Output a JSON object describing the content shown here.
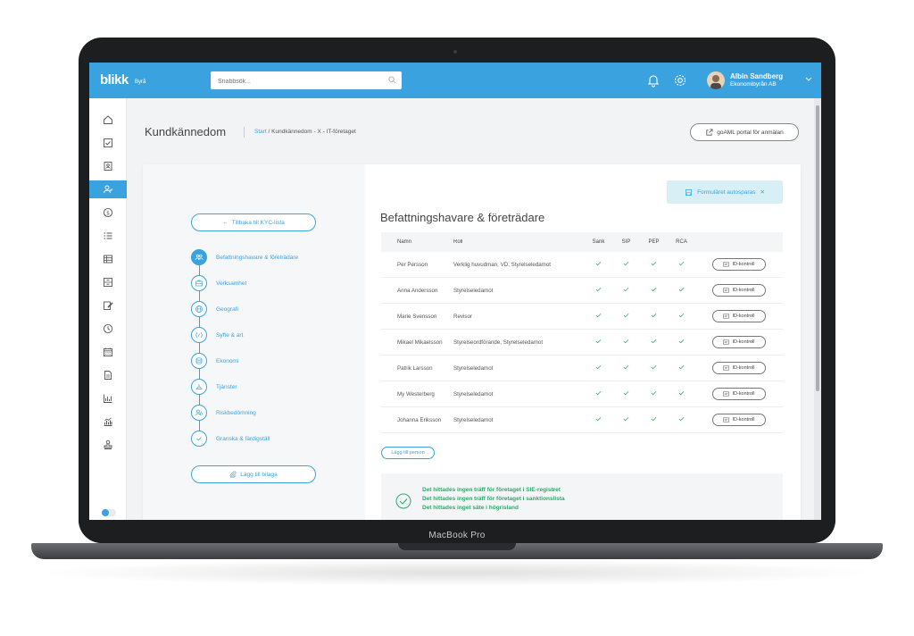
{
  "header": {
    "logo": "blikk",
    "logo_sub": "Byrå",
    "search_placeholder": "Snabbsök...",
    "user_name": "Albin Sandberg",
    "user_org": "Ekonomibyrån AB"
  },
  "sidebar": {
    "items": [
      "home-icon",
      "checkbox-icon",
      "contact-card-icon",
      "user-check-icon",
      "dollar-icon",
      "list-icon",
      "table-icon",
      "archive-icon",
      "edit-icon",
      "clock-icon",
      "calendar-icon",
      "document-icon",
      "bar-chart-icon",
      "analytics-icon",
      "stamp-icon"
    ]
  },
  "page": {
    "title": "Kundkännedom",
    "breadcrumb_link": "Start",
    "breadcrumb_rest": " / Kundkännedom - X - IT-företaget",
    "goaml_label": "goAML portal för anmälan"
  },
  "left": {
    "back_label": "Tillbaka till KYC-lista",
    "steps": [
      {
        "label": "Befattningshavare & företrädare",
        "icon": "people-icon"
      },
      {
        "label": "Verksamhet",
        "icon": "briefcase-icon"
      },
      {
        "label": "Geografi",
        "icon": "globe-icon"
      },
      {
        "label": "Syfte & art",
        "icon": "code-brackets-icon"
      },
      {
        "label": "Ekonomi",
        "icon": "coins-icon"
      },
      {
        "label": "Tjänster",
        "icon": "service-icon"
      },
      {
        "label": "Riskbedömning",
        "icon": "risk-icon"
      },
      {
        "label": "Granska & färdigställ",
        "icon": "check-icon"
      }
    ],
    "attach_label": "Lägg till bilaga"
  },
  "main": {
    "autosave_label": "Formuläret autosparas",
    "section_title": "Befattningshavare & företrädare",
    "columns": {
      "name": "Namn",
      "role": "Roll",
      "sank": "Sank",
      "sip": "SIP",
      "pep": "PEP",
      "rca": "RCA"
    },
    "id_button_label": "ID-kontroll",
    "rows": [
      {
        "name": "Per Persson",
        "role": "Verklig huvudman, VD, Styrelseledamot"
      },
      {
        "name": "Anna Andersson",
        "role": "Styrelseledamot"
      },
      {
        "name": "Marie Svensson",
        "role": "Revisor"
      },
      {
        "name": "Mikael Mikaelsson",
        "role": "Styrelseordförande, Styrelseledamot"
      },
      {
        "name": "Patrik Larsson",
        "role": "Styrelseledamot"
      },
      {
        "name": "My Westerberg",
        "role": "Styrelseledamot"
      },
      {
        "name": "Johanna Eriksson",
        "role": "Styrelseledamot"
      }
    ],
    "add_person_label": "Lägg till person",
    "results": [
      "Det hittades ingen träff för företaget i SIE-registret",
      "Det hittades ingen träff för företaget i sanktionslista",
      "Det hittades inget säte i högrisland"
    ]
  },
  "device": {
    "label": "MacBook Pro"
  },
  "colors": {
    "accent": "#3aa3df",
    "success": "#2fa86d"
  }
}
